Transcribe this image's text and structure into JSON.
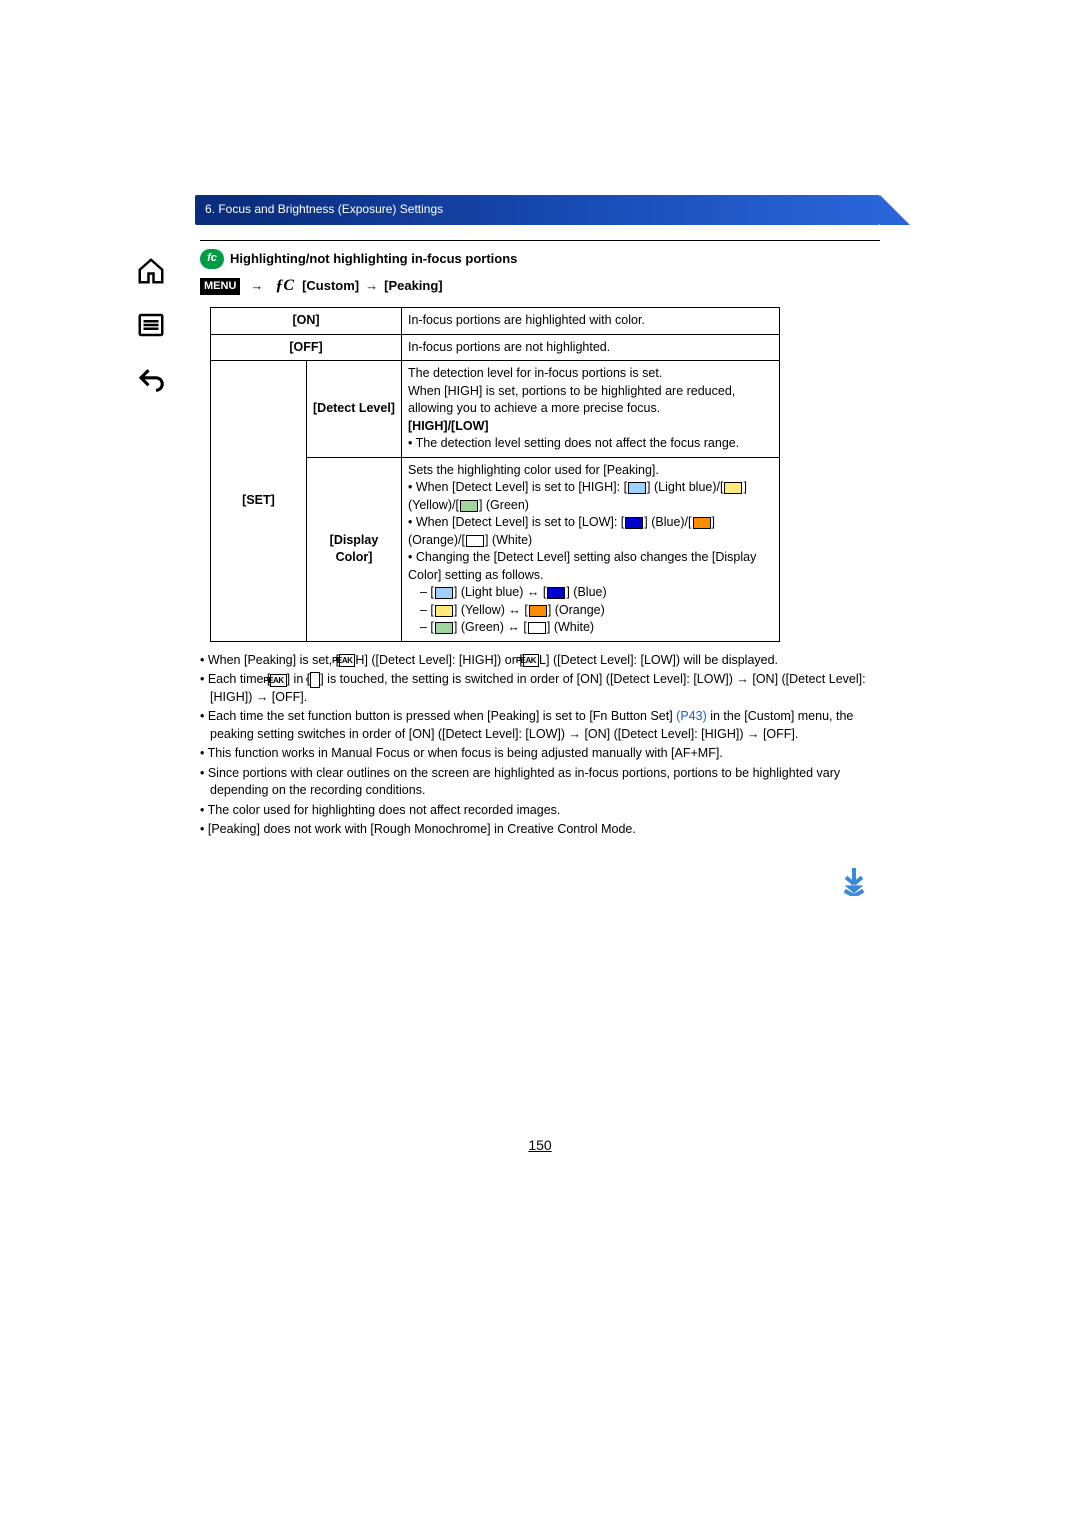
{
  "header": "6. Focus and Brightness (Exposure) Settings",
  "fc_badge": "fc",
  "title": "Highlighting/not highlighting in-focus portions",
  "menu_label": "MENU",
  "path_arrow": "→",
  "fc_symbol": "ƒC",
  "path_custom": "[Custom]",
  "path_peaking": "[Peaking]",
  "on_label": "[ON]",
  "on_desc": "In-focus portions are highlighted with color.",
  "off_label": "[OFF]",
  "off_desc": "In-focus portions are not highlighted.",
  "set_label": "[SET]",
  "detect_label": "[Detect Level]",
  "detect_desc_1": "The detection level for in-focus portions is set.",
  "detect_desc_2": "When [HIGH] is set, portions to be highlighted are reduced, allowing you to achieve a more precise focus.",
  "detect_opts": "[HIGH]/[LOW]",
  "detect_foot": "• The detection level setting does not affect the focus range.",
  "display_label": "[Display Color]",
  "dc_1": "Sets the highlighting color used for [Peaking].",
  "dc_2a": "• When [Detect Level] is set to [HIGH]: [",
  "dc_2b": "] (Light blue)/[",
  "dc_2c": "] (Yellow)/[",
  "dc_2d": "] (Green)",
  "dc_3a": "• When [Detect Level] is set to [LOW]: [",
  "dc_3b": "] (Blue)/[",
  "dc_3c": "] (Orange)/[",
  "dc_3d": "] (White)",
  "dc_4": "• Changing the [Detect Level] setting also changes the [Display Color] setting as follows.",
  "dc_map_a1": "– [",
  "dc_map_a2": "] (Light blue)",
  "dc_map_a3": "[",
  "dc_map_a4": "] (Blue)",
  "dc_map_b1": "– [",
  "dc_map_b2": "] (Yellow)",
  "dc_map_b3": "[",
  "dc_map_b4": "] (Orange)",
  "dc_map_c1": "– [",
  "dc_map_c2": "] (Green)",
  "dc_map_c3": "[",
  "dc_map_c4": "] (White)",
  "note1a": "• When [Peaking] is set, [",
  "note1_peakH": "PEAK",
  "note1_H": "H",
  "note1b": "] ([Detect Level]: [HIGH]) or [",
  "note1_peakL": "PEAK",
  "note1_L": "L",
  "note1c": "] ([Detect Level]: [LOW]) will be displayed.",
  "note2a": "• Each time [",
  "note2_icon_peak": "PEAK",
  "note2b": "] in [",
  "note2_tab": "‹",
  "note2c": "] is touched, the setting is switched in order of [ON] ([Detect Level]: [LOW]) → [ON] ([Detect Level]: [HIGH]) → [OFF].",
  "note3a": "• Each time the set function button is pressed when [Peaking] is set to [Fn Button Set] ",
  "note3_link": "(P43)",
  "note3b": " in the [Custom] menu, the peaking setting switches in order of [ON] ([Detect Level]: [LOW]) → [ON] ([Detect Level]: [HIGH]) → [OFF].",
  "note4": "• This function works in Manual Focus or when focus is being adjusted manually with [AF+MF].",
  "note5": "• Since portions with clear outlines on the screen are highlighted as in-focus portions, portions to be highlighted vary depending on the recording conditions.",
  "note6": "• The color used for highlighting does not affect recorded images.",
  "note7": "• [Peaking] does not work with [Rough Monochrome] in Creative Control Mode.",
  "page_number": "150"
}
